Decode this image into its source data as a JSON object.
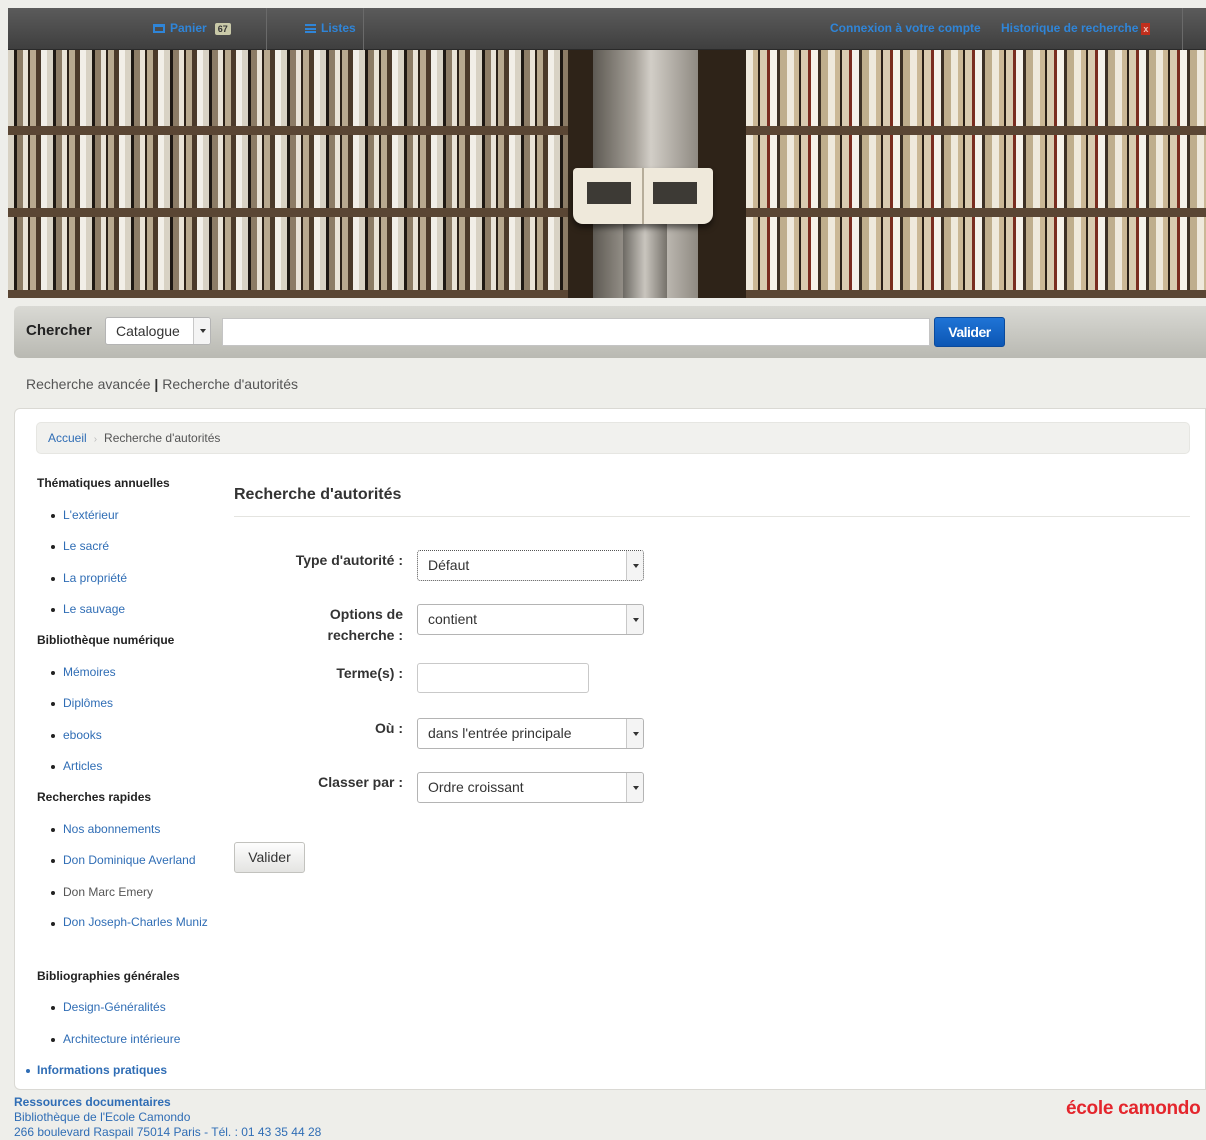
{
  "topbar": {
    "cart_label": "Panier",
    "cart_count": "67",
    "lists_label": "Listes",
    "login_label": "Connexion à votre compte",
    "history_label": "Historique de recherche",
    "history_clear": "x"
  },
  "search": {
    "label": "Chercher",
    "scope": "Catalogue",
    "query": "",
    "submit": "Valider"
  },
  "links": {
    "advanced": "Recherche avancée",
    "separator": "|",
    "authorities": "Recherche d'autorités"
  },
  "breadcrumb": {
    "home": "Accueil",
    "current": "Recherche d'autorités"
  },
  "sidebar": {
    "sections": [
      {
        "title": "Thématiques annuelles",
        "items": [
          "L'extérieur",
          "Le sacré",
          "La propriété",
          "Le sauvage"
        ]
      },
      {
        "title": "Bibliothèque numérique",
        "items": [
          "Mémoires",
          "Diplômes",
          "ebooks",
          "Articles"
        ]
      },
      {
        "title": "Recherches rapides",
        "items": [
          "Nos abonnements",
          "Don Dominique Averland",
          "Don Marc Emery",
          "Don Joseph-Charles Muniz"
        ]
      },
      {
        "title": "Bibliographies générales",
        "items": [
          "Design-Généralités",
          "Architecture intérieure"
        ]
      }
    ],
    "info": "Informations pratiques"
  },
  "form": {
    "title": "Recherche d'autorités",
    "type_label": "Type d'autorité :",
    "type_value": "Défaut",
    "options_label_1": "Options de",
    "options_label_2": "recherche :",
    "options_value": "contient",
    "terms_label": "Terme(s) :",
    "terms_value": "",
    "where_label": "Où :",
    "where_value": "dans l'entrée principale",
    "sort_label": "Classer par :",
    "sort_value": "Ordre croissant",
    "submit": "Valider"
  },
  "footer": {
    "line1": "Ressources documentaires",
    "line2": "Bibliothèque de l'Ecole Camondo",
    "line3": "266 boulevard Raspail 75014 Paris - Tél. : 01 43 35 44 28",
    "logo": "école camondo"
  },
  "colors": {
    "link": "#2f6db5",
    "primary_button": "#1565c8",
    "logo": "#e4262d"
  }
}
